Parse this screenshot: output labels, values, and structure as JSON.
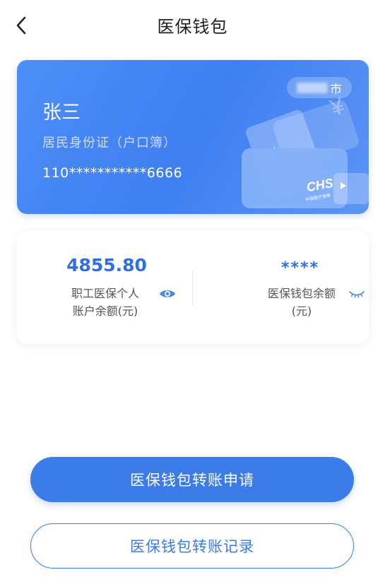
{
  "header": {
    "title": "医保钱包",
    "back_icon": "chevron-left-icon"
  },
  "id_card": {
    "name": "张三",
    "doc_type": "居民身份证（户口簿）",
    "id_number": "110***********6666",
    "city_suffix": "市",
    "logo_text": "CHS",
    "logo_subtext": "中国医疗保障",
    "colors": {
      "gradient_start": "#4e8ef7",
      "gradient_end": "#5d95f6"
    }
  },
  "balance": {
    "personal_account": {
      "amount": "4855.80",
      "label_line1": "职工医保个人",
      "label_line2": "账户余额(元)",
      "toggle_icon": "eye-open-icon"
    },
    "wallet": {
      "amount_masked": "****",
      "label_line1": "医保钱包余额",
      "label_line2": "(元)",
      "toggle_icon": "eye-closed-icon"
    },
    "accent_color": "#2f6fe4"
  },
  "actions": {
    "transfer_apply": "医保钱包转账申请",
    "transfer_records": "医保钱包转账记录",
    "primary_color": "#3b7ce9"
  }
}
